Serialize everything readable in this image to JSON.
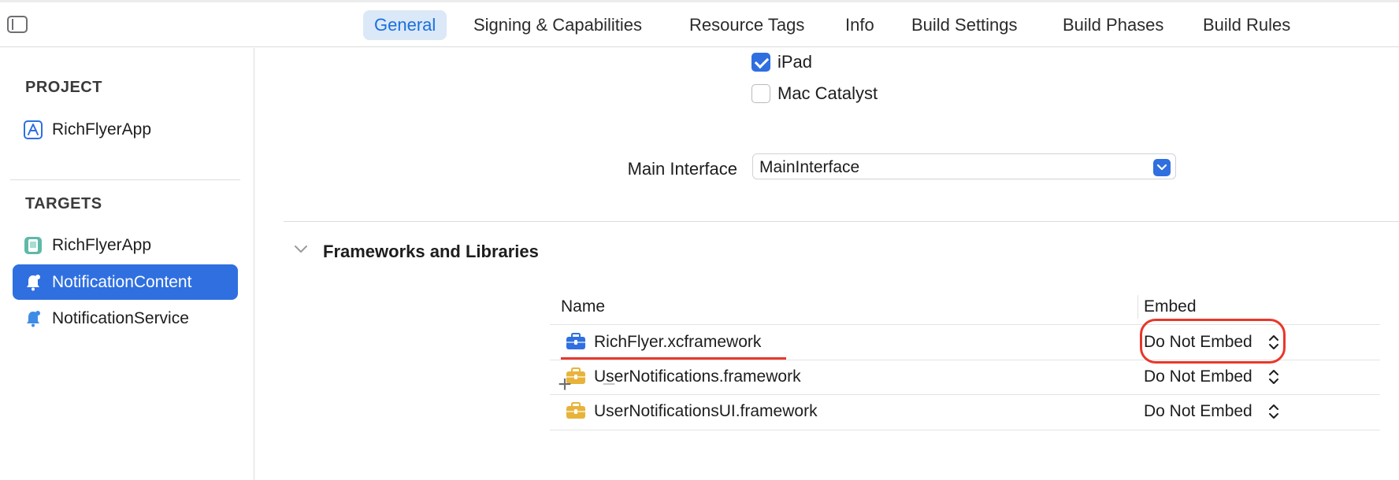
{
  "tabs": [
    "General",
    "Signing & Capabilities",
    "Resource Tags",
    "Info",
    "Build Settings",
    "Build Phases",
    "Build Rules"
  ],
  "active_tab": "General",
  "sidebar": {
    "project_header": "PROJECT",
    "project_items": [
      {
        "label": "RichFlyerApp",
        "icon": "app-project-icon"
      }
    ],
    "targets_header": "TARGETS",
    "target_items": [
      {
        "label": "RichFlyerApp",
        "icon": "app-target-icon"
      },
      {
        "label": "NotificationContent",
        "icon": "bell-icon",
        "selected": true
      },
      {
        "label": "NotificationService",
        "icon": "bell-icon"
      }
    ]
  },
  "main": {
    "devices": [
      {
        "label": "iPad",
        "checked": true
      },
      {
        "label": "Mac Catalyst",
        "checked": false
      }
    ],
    "main_interface_label": "Main Interface",
    "main_interface_value": "MainInterface",
    "frameworks_section_title": "Frameworks and Libraries",
    "table": {
      "columns": [
        "Name",
        "Embed"
      ],
      "rows": [
        {
          "name": "RichFlyer.xcframework",
          "embed": "Do Not Embed",
          "icon_color": "#2f6fe0"
        },
        {
          "name": "UserNotifications.framework",
          "embed": "Do Not Embed",
          "icon_color": "#e8b33a"
        },
        {
          "name": "UserNotificationsUI.framework",
          "embed": "Do Not Embed",
          "icon_color": "#e8b33a"
        }
      ]
    },
    "add_label": "+",
    "remove_label": "−"
  },
  "colors": {
    "accent": "#2f6fe0",
    "annotation": "#e8372a",
    "framework_icon": "#e8b33a"
  }
}
